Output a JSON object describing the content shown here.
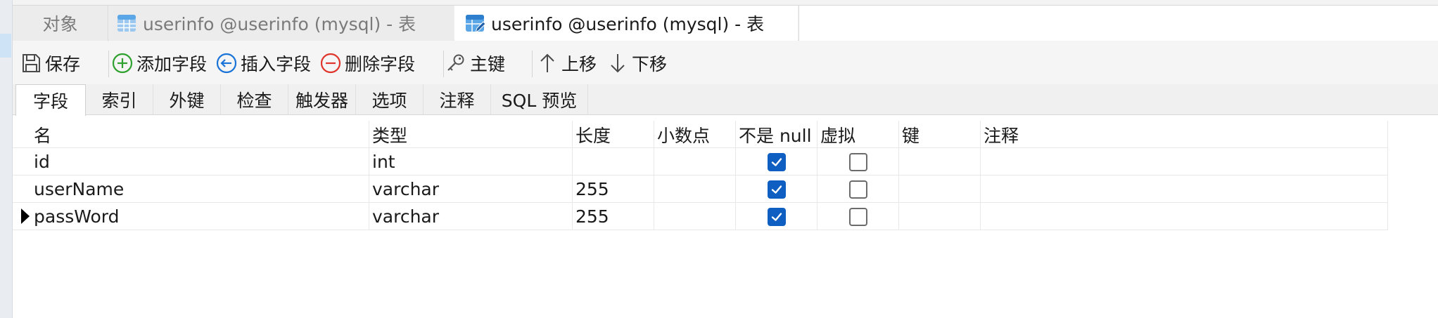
{
  "tabs": {
    "objects": "对象",
    "tab1": "userinfo @userinfo (mysql) - 表",
    "tab2": "userinfo @userinfo (mysql) - 表"
  },
  "toolbar": {
    "save": "保存",
    "add_field": "添加字段",
    "insert_field": "插入字段",
    "delete_field": "删除字段",
    "primary_key": "主键",
    "move_up": "上移",
    "move_down": "下移"
  },
  "subtabs": [
    "字段",
    "索引",
    "外键",
    "检查",
    "触发器",
    "选项",
    "注释",
    "SQL 预览"
  ],
  "columns": [
    "名",
    "类型",
    "长度",
    "小数点",
    "不是 null",
    "虚拟",
    "键",
    "注释"
  ],
  "rows": [
    {
      "name": "id",
      "type": "int",
      "length": "",
      "decimals": "",
      "not_null": true,
      "virtual": false,
      "key": "",
      "comment": ""
    },
    {
      "name": "userName",
      "type": "varchar",
      "length": "255",
      "decimals": "",
      "not_null": true,
      "virtual": false,
      "key": "",
      "comment": ""
    },
    {
      "name": "passWord",
      "type": "varchar",
      "length": "255",
      "decimals": "",
      "not_null": true,
      "virtual": false,
      "key": "",
      "comment": ""
    }
  ],
  "colors": {
    "accent": "#0f5fc2",
    "add_icon": "#2fa12f",
    "insert_icon": "#1a73d9",
    "delete_icon": "#e0352b"
  }
}
